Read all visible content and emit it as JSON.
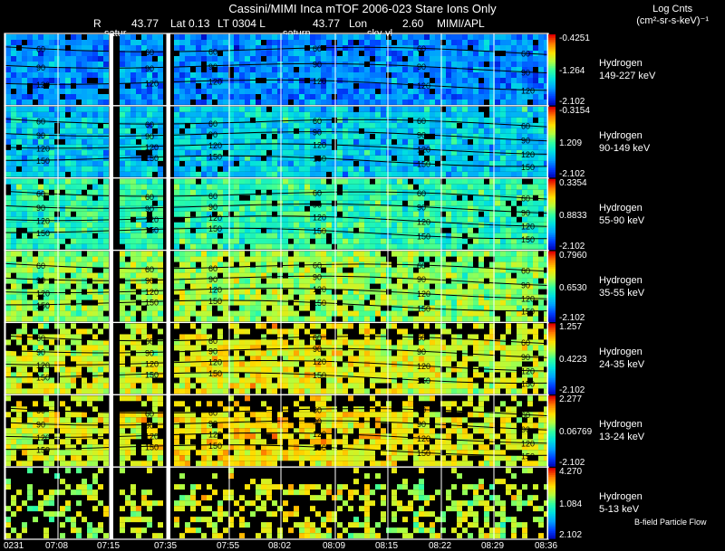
{
  "header": {
    "title": "Cassini/MIMI Inca mTOF  2006-023   Stare   Ions Only",
    "subtitle": {
      "r_label": "R",
      "r_value": "43.77",
      "lat": "Lat 0.13",
      "lt": "LT 0304 L",
      "lon_value": "43.77",
      "lon": "Lon",
      "scale": "2.60",
      "credit": "MIMI/APL"
    },
    "markers": [
      "satur",
      "saturn",
      "sky-vl"
    ]
  },
  "legend": {
    "title_line1": "Log Cnts",
    "title_line2": "(cm²-sr-s-keV)⁻¹"
  },
  "footer_note": "B-field Particle Flow",
  "colors": {
    "background": "#000000",
    "grid": "#ffffff",
    "colormap": [
      "#0000b4",
      "#0040ff",
      "#00a0ff",
      "#00e0e0",
      "#30ffa0",
      "#b0ff40",
      "#ffe000",
      "#ff8000",
      "#e00000"
    ]
  },
  "chart_data": {
    "type": "heatmap",
    "x_tick_labels": [
      "0231",
      "07:08",
      "07:15",
      "07:35",
      "07:55",
      "08:02",
      "08:09",
      "08:15",
      "08:22",
      "08:29",
      "08:36"
    ],
    "panels": [
      {
        "species": "Hydrogen",
        "energy": "149-227 keV",
        "cmax": "-0.4251",
        "cmid": "-1.264",
        "cmin": "-2.102",
        "level": 0.22,
        "spread": 0.14,
        "empty": 0.05,
        "contours": [
          "60",
          "90",
          "120"
        ]
      },
      {
        "species": "Hydrogen",
        "energy": "90-149 keV",
        "cmax": "-0.3154",
        "cmid": "1.209",
        "cmin": "-2.102",
        "level": 0.33,
        "spread": 0.16,
        "empty": 0.05,
        "contours": [
          "60",
          "90",
          "120",
          "150"
        ]
      },
      {
        "species": "Hydrogen",
        "energy": "55-90 keV",
        "cmax": "0.3354",
        "cmid": "0.8833",
        "cmin": "-2.102",
        "level": 0.46,
        "spread": 0.14,
        "empty": 0.06,
        "contours": [
          "60",
          "90",
          "120",
          "150"
        ]
      },
      {
        "species": "Hydrogen",
        "energy": "35-55 keV",
        "cmax": "0.7960",
        "cmid": "0.6530",
        "cmin": "-2.102",
        "level": 0.58,
        "spread": 0.14,
        "empty": 0.08,
        "contours": [
          "60",
          "90",
          "120",
          "150"
        ]
      },
      {
        "species": "Hydrogen",
        "energy": "24-35 keV",
        "cmax": "1.257",
        "cmid": "0.4223",
        "cmin": "-2.102",
        "level": 0.66,
        "spread": 0.13,
        "empty": 0.12,
        "contours": [
          "60",
          "90",
          "120",
          "150"
        ]
      },
      {
        "species": "Hydrogen",
        "energy": "13-24 keV",
        "cmax": "2.277",
        "cmid": "0.06769",
        "cmin": "-2.102",
        "level": 0.68,
        "spread": 0.12,
        "empty": 0.2,
        "contours": [
          "60",
          "90",
          "120",
          "150"
        ]
      },
      {
        "species": "Hydrogen",
        "energy": "5-13 keV",
        "cmax": "4.270",
        "cmid": "1.084",
        "cmin": "2.102",
        "level": 0.62,
        "spread": 0.14,
        "empty": 0.55,
        "contours": []
      }
    ]
  }
}
